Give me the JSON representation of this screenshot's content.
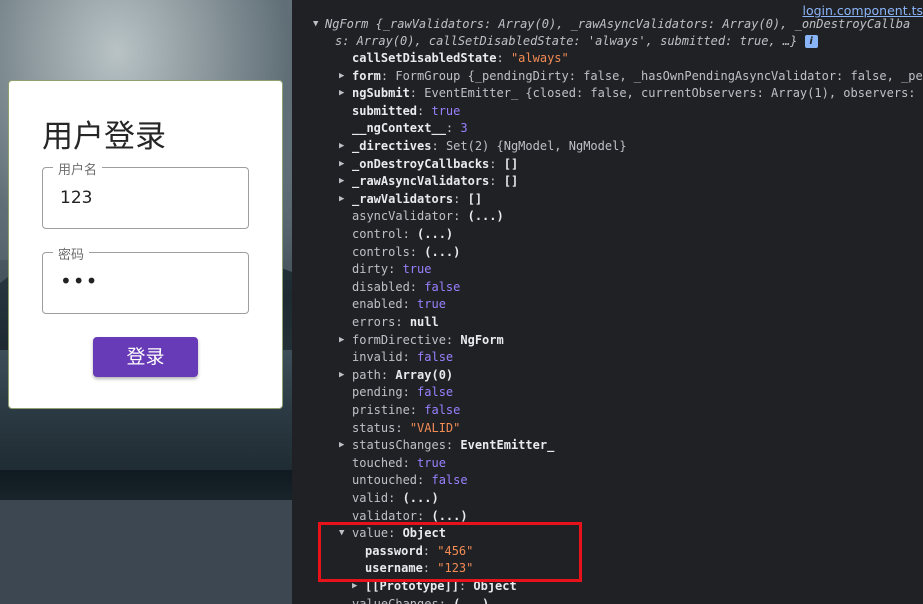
{
  "login": {
    "title": "用户登录",
    "username_label": "用户名",
    "username_value": "123",
    "password_label": "密码",
    "password_mask": "•••",
    "submit_label": "登录"
  },
  "devtools": {
    "source_link": "login.component.ts",
    "header_line1": "NgForm {_rawValidators: Array(0), _rawAsyncValidators: Array(0), _onDestroyCallba",
    "header_line2": "s: Array(0), callSetDisabledState: 'always', submitted: true, …}",
    "info_icon": "i",
    "props": [
      {
        "key": "callSetDisabledState",
        "sep": ": ",
        "val": "\"always\"",
        "type": "str",
        "expand": false
      },
      {
        "key": "form",
        "sep": ": ",
        "val": "FormGroup {_pendingDirty: false, _hasOwnPendingAsyncValidator: false, _pe",
        "type": "plain",
        "expand": true
      },
      {
        "key": "ngSubmit",
        "sep": ": ",
        "val": "EventEmitter_ {closed: false, currentObservers: Array(1), observers:",
        "type": "plain",
        "expand": true
      },
      {
        "key": "submitted",
        "sep": ": ",
        "val": "true",
        "type": "kw",
        "expand": false
      },
      {
        "key": "__ngContext__",
        "sep": ": ",
        "val": "3",
        "type": "num",
        "expand": false
      },
      {
        "key": "_directives",
        "sep": ": ",
        "val": "Set(2) {NgModel, NgModel}",
        "type": "plain",
        "expand": true
      },
      {
        "key": "_onDestroyCallbacks",
        "sep": ": ",
        "val": "[]",
        "type": "plain",
        "expand": true
      },
      {
        "key": "_rawAsyncValidators",
        "sep": ": ",
        "val": "[]",
        "type": "plain",
        "expand": true
      },
      {
        "key": "_rawValidators",
        "sep": ": ",
        "val": "[]",
        "type": "plain",
        "expand": true
      },
      {
        "key": "asyncValidator",
        "sep": ": ",
        "val": "(...)",
        "type": "plain",
        "expand": false,
        "dim": true
      },
      {
        "key": "control",
        "sep": ": ",
        "val": "(...)",
        "type": "plain",
        "expand": false,
        "dim": true
      },
      {
        "key": "controls",
        "sep": ": ",
        "val": "(...)",
        "type": "plain",
        "expand": false,
        "dim": true
      },
      {
        "key": "dirty",
        "sep": ": ",
        "val": "true",
        "type": "kw",
        "expand": false,
        "dim": true
      },
      {
        "key": "disabled",
        "sep": ": ",
        "val": "false",
        "type": "kw",
        "expand": false,
        "dim": true
      },
      {
        "key": "enabled",
        "sep": ": ",
        "val": "true",
        "type": "kw",
        "expand": false,
        "dim": true
      },
      {
        "key": "errors",
        "sep": ": ",
        "val": "null",
        "type": "plain",
        "expand": false,
        "dim": true
      },
      {
        "key": "formDirective",
        "sep": ": ",
        "val": "NgForm",
        "type": "plain",
        "expand": true,
        "dim": true
      },
      {
        "key": "invalid",
        "sep": ": ",
        "val": "false",
        "type": "kw",
        "expand": false,
        "dim": true
      },
      {
        "key": "path",
        "sep": ": ",
        "val": "Array(0)",
        "type": "plain",
        "expand": true,
        "dim": true
      },
      {
        "key": "pending",
        "sep": ": ",
        "val": "false",
        "type": "kw",
        "expand": false,
        "dim": true
      },
      {
        "key": "pristine",
        "sep": ": ",
        "val": "false",
        "type": "kw",
        "expand": false,
        "dim": true
      },
      {
        "key": "status",
        "sep": ": ",
        "val": "\"VALID\"",
        "type": "str",
        "expand": false,
        "dim": true
      },
      {
        "key": "statusChanges",
        "sep": ": ",
        "val": "EventEmitter_",
        "type": "plain",
        "expand": true,
        "dim": true
      },
      {
        "key": "touched",
        "sep": ": ",
        "val": "true",
        "type": "kw",
        "expand": false,
        "dim": true
      },
      {
        "key": "untouched",
        "sep": ": ",
        "val": "false",
        "type": "kw",
        "expand": false,
        "dim": true
      },
      {
        "key": "valid",
        "sep": ": ",
        "val": "(...)",
        "type": "plain",
        "expand": false,
        "dim": true
      },
      {
        "key": "validator",
        "sep": ": ",
        "val": "(...)",
        "type": "plain",
        "expand": false,
        "dim": true
      },
      {
        "key": "value",
        "sep": ": ",
        "val": "Object",
        "type": "plain",
        "expand": "open",
        "dim": true
      },
      {
        "key": "password",
        "sep": ": ",
        "val": "\"456\"",
        "type": "str",
        "expand": false,
        "indent": 1
      },
      {
        "key": "username",
        "sep": ": ",
        "val": "\"123\"",
        "type": "str",
        "expand": false,
        "indent": 1
      },
      {
        "key": "[[Prototype]]",
        "sep": ": ",
        "val": "Object",
        "type": "plain",
        "expand": true,
        "indent": 1,
        "dim": true
      },
      {
        "key": "valueChanges",
        "sep": ": ",
        "val": "(...)",
        "type": "plain",
        "expand": false,
        "dim": true
      }
    ]
  },
  "colors": {
    "button_accent": "#673ab7",
    "highlight_border": "#e8121b",
    "devtools_bg": "#202124"
  }
}
